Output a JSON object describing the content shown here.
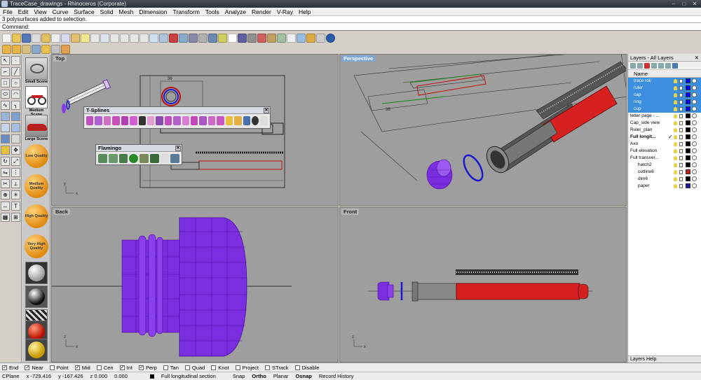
{
  "window": {
    "title": "TraceCase_drawings - Rhinoceros (Corporate)"
  },
  "menu": [
    "File",
    "Edit",
    "View",
    "Curve",
    "Surface",
    "Solid",
    "Mesh",
    "Dimension",
    "Transform",
    "Tools",
    "Analyze",
    "Render",
    "V-Ray",
    "Help"
  ],
  "command": {
    "history": "3 polysurfaces added to selection.",
    "prompt": "Command:"
  },
  "vray_toolbar": {
    "scenes": [
      "Small Scene",
      "Medium Scene",
      "Large Scene"
    ],
    "quality": [
      "Low Quality",
      "Medium Quality",
      "High Quality",
      "Very High Quality"
    ]
  },
  "viewports": {
    "top": "Top",
    "perspective": "Perspective",
    "back": "Back",
    "front": "Front"
  },
  "axis_labels": {
    "x": "x",
    "y": "y",
    "z": "z"
  },
  "drawing_dimension": "36",
  "floating_toolbars": {
    "tsplines": "T-Splines",
    "flamingo": "Flamingo"
  },
  "layers_panel": {
    "title": "Layers - All Layers",
    "column_name": "Name",
    "footer": "Layers  Help",
    "rows": [
      {
        "name": "trace roll",
        "selected": true,
        "color": "#0000ff"
      },
      {
        "name": "ruler",
        "selected": true,
        "color": "#0000ff"
      },
      {
        "name": "cap",
        "selected": true,
        "color": "#0000ff"
      },
      {
        "name": "ring",
        "selected": true,
        "color": "#0000ff"
      },
      {
        "name": "cup",
        "selected": true,
        "color": "#0000ff"
      },
      {
        "name": "letter page - ...",
        "selected": false,
        "color": "#000000"
      },
      {
        "name": "Cap_side view",
        "selected": false,
        "color": "#000000"
      },
      {
        "name": "Ruler_plan",
        "selected": false,
        "color": "#000000"
      },
      {
        "name": "Full longit...",
        "selected": false,
        "color": "#000000",
        "current": true
      },
      {
        "name": "Axo",
        "selected": false,
        "color": "#000000"
      },
      {
        "name": "Full elevation",
        "selected": false,
        "color": "#000000"
      },
      {
        "name": "Full transver...",
        "selected": false,
        "color": "#000000"
      },
      {
        "name": "hatch2",
        "selected": false,
        "color": "#000000"
      },
      {
        "name": "outline6",
        "selected": false,
        "color": "#c81e1e"
      },
      {
        "name": "dim6",
        "selected": false,
        "color": "#000000"
      },
      {
        "name": "paper",
        "selected": false,
        "color": "#1a1aa0"
      }
    ]
  },
  "osnap": [
    {
      "label": "End",
      "checked": true
    },
    {
      "label": "Near",
      "checked": true
    },
    {
      "label": "Point",
      "checked": false
    },
    {
      "label": "Mid",
      "checked": true
    },
    {
      "label": "Cen",
      "checked": false
    },
    {
      "label": "Int",
      "checked": true
    },
    {
      "label": "Perp",
      "checked": true
    },
    {
      "label": "Tan",
      "checked": false
    },
    {
      "label": "Quad",
      "checked": false
    },
    {
      "label": "Knot",
      "checked": false
    },
    {
      "label": "Project",
      "checked": false
    },
    {
      "label": "STrack",
      "checked": false
    },
    {
      "label": "Disable",
      "checked": false
    }
  ],
  "status": {
    "cplane": "CPlane",
    "x": "x -729.416",
    "y": "y -167.426",
    "z": "z 0.000",
    "value": "0.000",
    "layer": "Full longitudinal section",
    "snap": "Snap",
    "ortho": "Ortho",
    "planar": "Planar",
    "osnap": "Osnap",
    "record": "Record History"
  }
}
